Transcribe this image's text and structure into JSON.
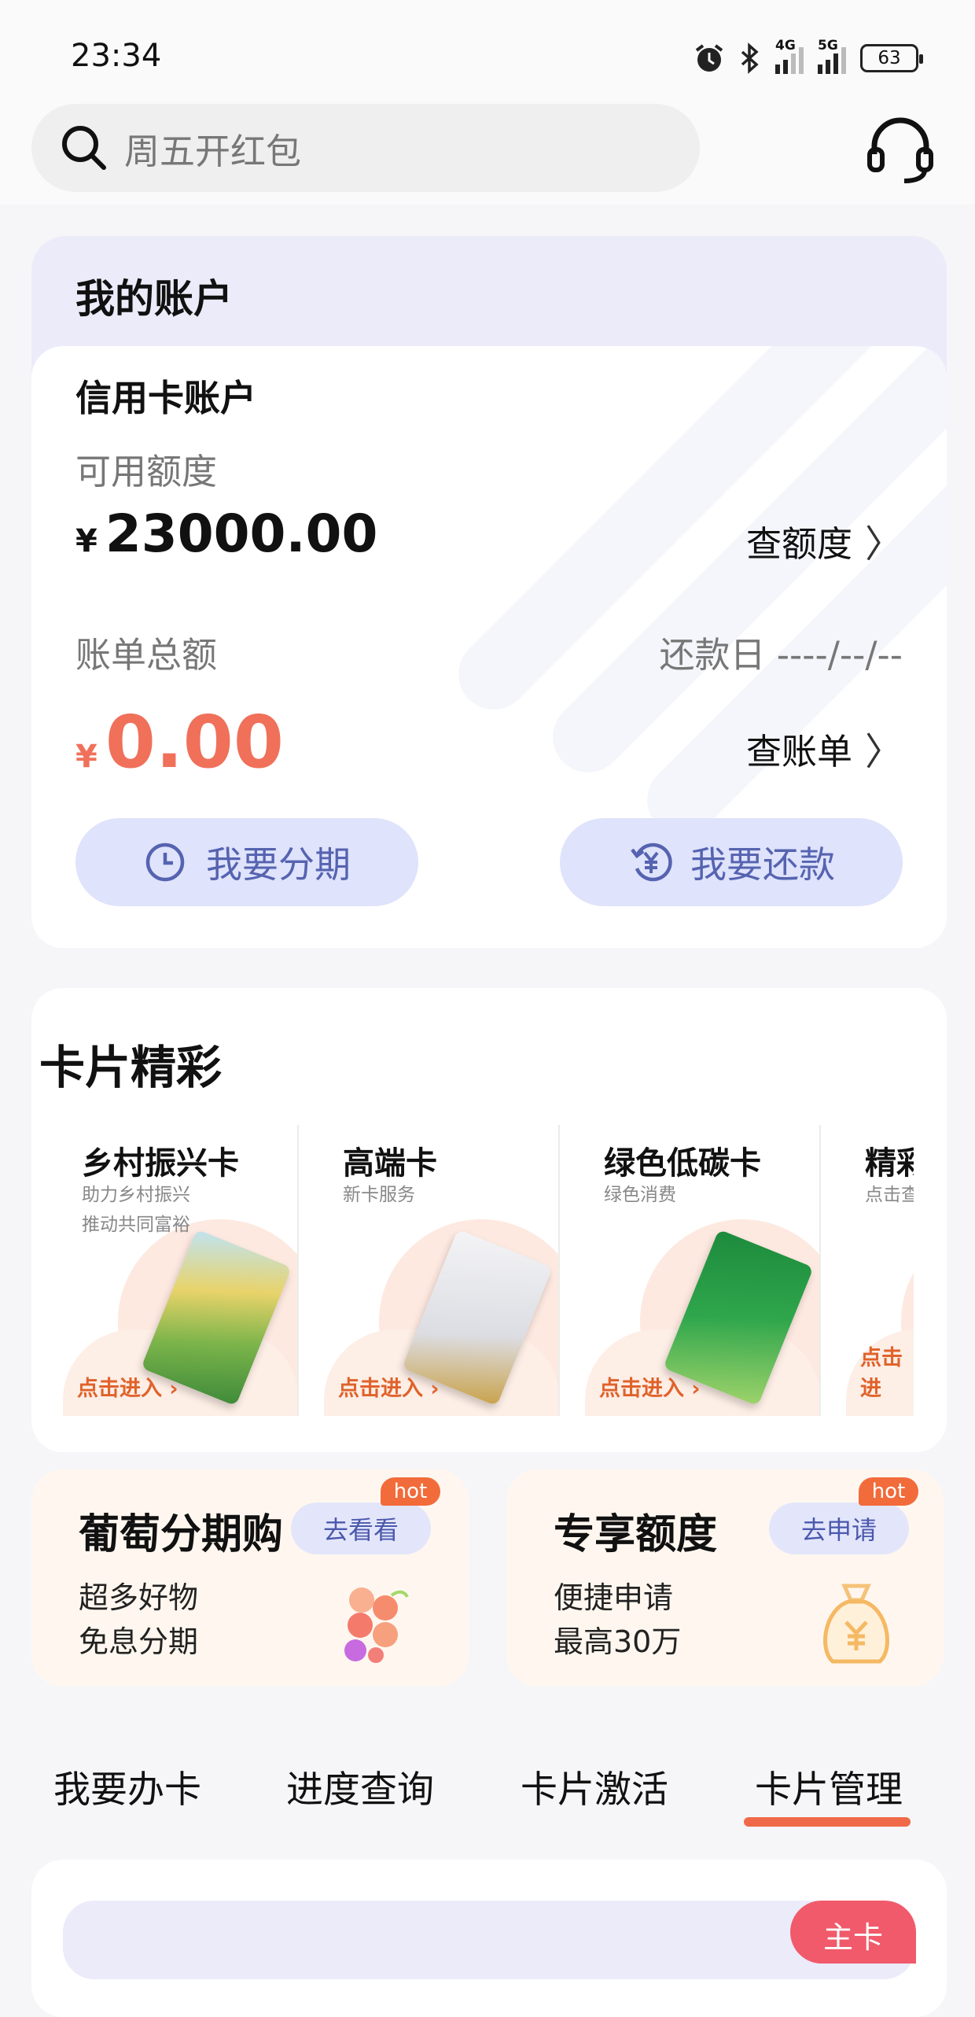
{
  "status_bar": {
    "time": "23:34",
    "network_1": "4G",
    "network_2": "5G",
    "battery": "63"
  },
  "search": {
    "placeholder": "周五开红包"
  },
  "account": {
    "title": "我的账户",
    "card_type": "信用卡账户",
    "available_label": "可用额度",
    "currency": "¥",
    "available_amount": "23000.00",
    "check_limit": "查额度",
    "bill_label": "账单总额",
    "due_label": "还款日 ----/--/--",
    "bill_amount": "0.00",
    "check_bill": "查账单",
    "installment_btn": "我要分期",
    "repay_btn": "我要还款"
  },
  "cards_section": {
    "title": "卡片精彩",
    "items": [
      {
        "name": "乡村振兴卡",
        "sub1": "助力乡村振兴",
        "sub2": "推动共同富裕",
        "cta": "点击进入 ›"
      },
      {
        "name": "高端卡",
        "sub1": "新卡服务",
        "sub2": "",
        "cta": "点击进入 ›"
      },
      {
        "name": "绿色低碳卡",
        "sub1": "绿色消费",
        "sub2": "",
        "cta": "点击进入 ›"
      },
      {
        "name": "精彩",
        "sub1": "点击查",
        "sub2": "",
        "cta": "点击进"
      }
    ]
  },
  "promos": [
    {
      "title": "葡萄分期购",
      "button": "去看看",
      "badge": "hot",
      "line1": "超多好物",
      "line2": "免息分期"
    },
    {
      "title": "专享额度",
      "button": "去申请",
      "badge": "hot",
      "line1": "便捷申请",
      "line2": "最高30万"
    }
  ],
  "tabs": [
    "我要办卡",
    "进度查询",
    "卡片激活",
    "卡片管理"
  ],
  "active_tab": "卡片管理",
  "bottom_card": {
    "badge": "主卡"
  },
  "colors": {
    "accent": "#f06a4a",
    "amount_red": "#f0705a",
    "button_bg": "#dfe3fb",
    "button_text": "#5563b0"
  }
}
